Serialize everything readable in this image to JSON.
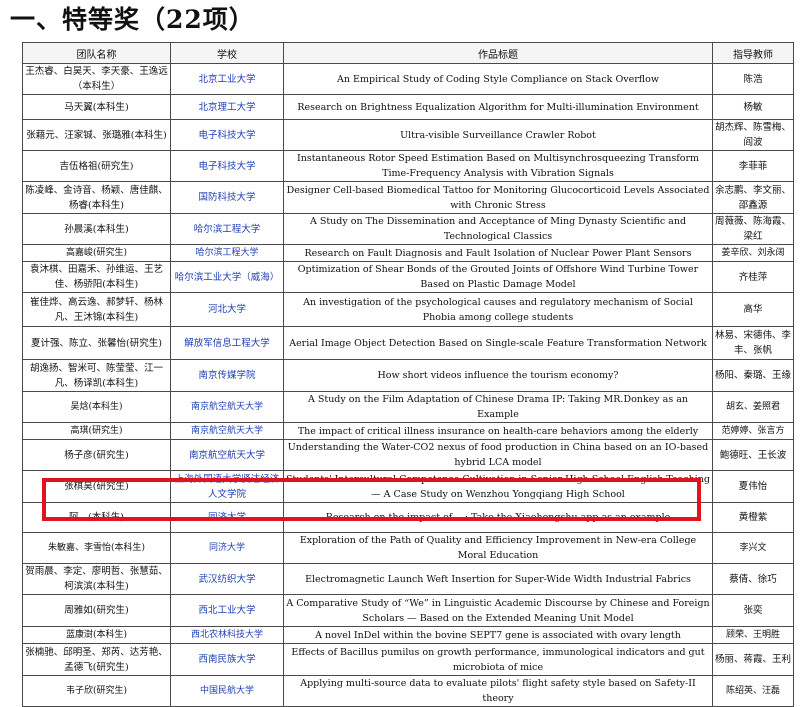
{
  "page": {
    "title": "一、特等奖（22项）"
  },
  "table": {
    "headers": {
      "team": "团队名称",
      "school": "学校",
      "title": "作品标题",
      "advisor": "指导教师"
    },
    "rows": [
      {
        "team": "王杰睿、白昊天、李天豪、王逸远（本科生）",
        "school": "北京工业大学",
        "title": "An Empirical Study of Coding Style Compliance on Stack Overflow",
        "advisor": "陈浩"
      },
      {
        "team": "马天翼(本科生)",
        "school": "北京理工大学",
        "title": "Research on Brightness Equalization Algorithm for Multi-illumination Environment",
        "advisor": "杨敏"
      },
      {
        "team": "张藉元、汪家铖、张璐雅(本科生)",
        "school": "电子科技大学",
        "title": "Ultra-visible Surveillance Crawler Robot",
        "advisor": "胡杰辉、陈雪梅、阎波"
      },
      {
        "team": "吉伍格祖(研究生)",
        "school": "电子科技大学",
        "title": "Instantaneous Rotor Speed Estimation Based on Multisynchrosqueezing Transform Time-Frequency Analysis with Vibration Signals",
        "advisor": "李菲菲"
      },
      {
        "team": "陈凌峰、金诗音、杨颖、唐佳麒、杨睿(本科生)",
        "school": "国防科技大学",
        "title": "Designer Cell-based Biomedical Tattoo for Monitoring Glucocorticoid Levels Associated with Chronic Stress",
        "advisor": "余志鹏、李文丽、邵鑫源"
      },
      {
        "team": "孙晨溪(本科生)",
        "school": "哈尔滨工程大学",
        "title": "A Study on The Dissemination and Acceptance of Ming Dynasty Scientific and Technological Classics",
        "advisor": "周薇薇、陈海霞、梁红"
      },
      {
        "team": "高嘉峻(研究生)",
        "school": "哈尔滨工程大学",
        "title": "Research on Fault Diagnosis and Fault Isolation of Nuclear Power Plant Sensors",
        "advisor": "姜辛欣、刘永阔"
      },
      {
        "team": "袁沐棋、田嘉禾、孙维运、王艺佳、杨骄阳(本科生)",
        "school": "哈尔滨工业大学（威海）",
        "title": "Optimization of Shear Bonds of the Grouted Joints of Offshore Wind Turbine Tower Based on Plastic Damage Model",
        "advisor": "齐桂萍"
      },
      {
        "team": "崔佳烨、高云逸、郝梦轩、杨林凡、王沐锦(本科生)",
        "school": "河北大学",
        "title": "An investigation of the psychological causes and regulatory mechanism of Social Phobia among college students",
        "advisor": "高华"
      },
      {
        "team": "夏计强、陈立、张馨怡(研究生)",
        "school": "解放军信息工程大学",
        "title": "Aerial Image Object Detection Based on Single-scale Feature Transformation Network",
        "advisor": "林易、宋德伟、李丰、张帆"
      },
      {
        "team": "胡逸扬、智米可、陈莹莹、江一凡、杨译凯(本科生)",
        "school": "南京传媒学院",
        "title": "How short videos influence the tourism economy?",
        "advisor": "杨阳、秦璐、王缘"
      },
      {
        "team": "吴焓(本科生)",
        "school": "南京航空航天大学",
        "title": "A Study on the Film Adaptation of Chinese Drama IP: Taking MR.Donkey as an Example",
        "advisor": "胡玄、姜照君"
      },
      {
        "team": "高琪(研究生)",
        "school": "南京航空航天大学",
        "title": "The impact of critical illness insurance on health-care behaviors among the elderly",
        "advisor": "范婷婷、张言方"
      },
      {
        "team": "杨子彦(研究生)",
        "school": "南京航空航天大学",
        "title": "Understanding the Water-CO2 nexus of food production in China based on an IO-based hybrid LCA model",
        "advisor": "鲍德旺、王长波"
      },
      {
        "team": "张棋昊(研究生)",
        "school": "上海外国语大学贤达经济人文学院",
        "title": "Students' Intercultural Competence Cultivation in Senior High School English Teaching — A Case Study on Wenzhou Yongqiang High School",
        "advisor": "夏伟怡"
      },
      {
        "team": "阿…(本科生)",
        "school": "同济大学",
        "title": "Research on the impact of …: Take the Xiaohongshu app as an example",
        "advisor": "黄橙紫"
      },
      {
        "team": "朱敏嘉、李雪怡(本科生)",
        "school": "同济大学",
        "title": "Exploration of the Path of Quality and Efficiency Improvement in New-era College Moral Education",
        "advisor": "李兴文"
      },
      {
        "team": "贺雨晨、李定、廖明哲、张慧茹、柯滨滨(本科生)",
        "school": "武汉纺织大学",
        "title": "Electromagnetic Launch Weft Insertion for Super-Wide Width Industrial Fabrics",
        "advisor": "蔡倩、徐巧"
      },
      {
        "team": "周雅如(研究生)",
        "school": "西北工业大学",
        "title": "A Comparative Study of “We” in Linguistic Academic Discourse by Chinese and Foreign Scholars — Based on the Extended Meaning Unit Model",
        "advisor": "张奕"
      },
      {
        "team": "蓝康澍(本科生)",
        "school": "西北农林科技大学",
        "title": "A novel InDel within the bovine SEPT7 gene is associated with ovary length",
        "advisor": "顾荣、王明胜"
      },
      {
        "team": "张楠驰、邱明圣、郑芮、达芳艳、孟德飞(研究生)",
        "school": "西南民族大学",
        "title": "Effects of Bacillus pumilus on growth performance, immunological indicators and gut microbiota of mice",
        "advisor": "杨丽、蒋霞、王利"
      },
      {
        "team": "韦子欣(研究生)",
        "school": "中国民航大学",
        "title": "Applying multi-source data to evaluate pilots' flight safety style based on Safety-II theory",
        "advisor": "陈绍英、汪磊"
      }
    ]
  }
}
